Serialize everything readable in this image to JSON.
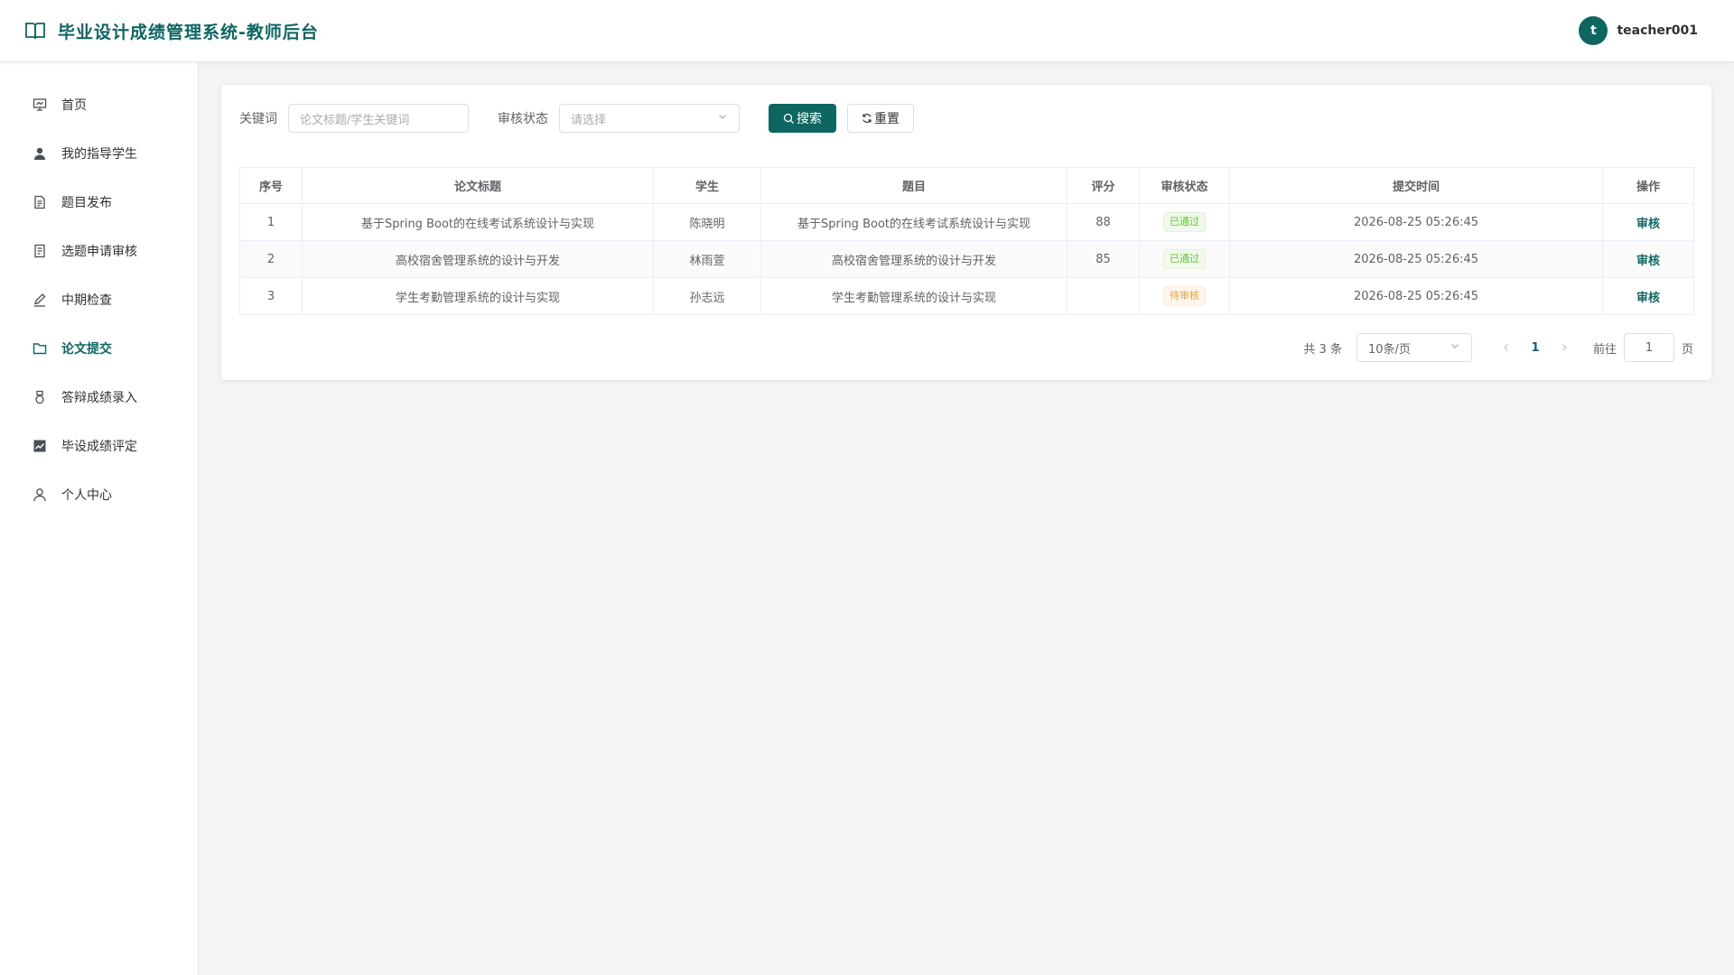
{
  "header": {
    "title": "毕业设计成绩管理系统-教师后台",
    "avatar_letter": "t",
    "username": "teacher001"
  },
  "sidebar": {
    "items": [
      {
        "label": "首页",
        "icon": "dashboard-icon",
        "active": false
      },
      {
        "label": "我的指导学生",
        "icon": "user-icon",
        "active": false
      },
      {
        "label": "题目发布",
        "icon": "document-icon",
        "active": false
      },
      {
        "label": "选题申请审核",
        "icon": "tickets-icon",
        "active": false
      },
      {
        "label": "中期检查",
        "icon": "edit-pen-icon",
        "active": false
      },
      {
        "label": "论文提交",
        "icon": "folder-icon",
        "active": true
      },
      {
        "label": "答辩成绩录入",
        "icon": "medal-icon",
        "active": false
      },
      {
        "label": "毕设成绩评定",
        "icon": "chart-icon",
        "active": false
      },
      {
        "label": "个人中心",
        "icon": "user-outline-icon",
        "active": false
      }
    ]
  },
  "filters": {
    "keyword_label": "关键词",
    "keyword_placeholder": "论文标题/学生关键词",
    "status_label": "审核状态",
    "status_placeholder": "请选择",
    "search_label": "搜索",
    "reset_label": "重置"
  },
  "table": {
    "columns": [
      "序号",
      "论文标题",
      "学生",
      "题目",
      "评分",
      "审核状态",
      "提交时间",
      "操作"
    ],
    "rows": [
      {
        "index": "1",
        "title": "基于Spring Boot的在线考试系统设计与实现",
        "student": "陈晓明",
        "topic": "基于Spring Boot的在线考试系统设计与实现",
        "score": "88",
        "status": "已通过",
        "status_type": "success",
        "time": "2026-08-25 05:26:45",
        "action": "审核"
      },
      {
        "index": "2",
        "title": "高校宿舍管理系统的设计与开发",
        "student": "林雨萱",
        "topic": "高校宿舍管理系统的设计与开发",
        "score": "85",
        "status": "已通过",
        "status_type": "success",
        "time": "2026-08-25 05:26:45",
        "action": "审核"
      },
      {
        "index": "3",
        "title": "学生考勤管理系统的设计与实现",
        "student": "孙志远",
        "topic": "学生考勤管理系统的设计与实现",
        "score": "",
        "status": "待审核",
        "status_type": "warning",
        "time": "2026-08-25 05:26:45",
        "action": "审核"
      }
    ]
  },
  "pagination": {
    "total_text": "共 3 条",
    "page_size": "10条/页",
    "current_page": "1",
    "goto_label": "前往",
    "goto_value": "1",
    "page_suffix": "页"
  },
  "colors": {
    "primary": "#0e6660",
    "success": "#67c23a",
    "warning": "#e6a23c"
  }
}
